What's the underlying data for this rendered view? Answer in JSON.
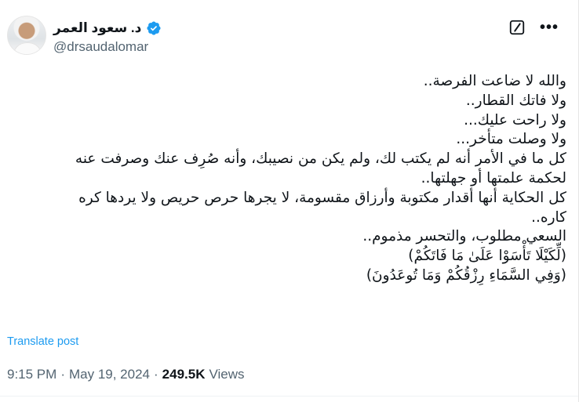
{
  "author": {
    "name": "د. سعود العمر",
    "handle": "@drsaudalomar"
  },
  "icons": {
    "verified": "verified-badge-icon",
    "grok": "grok-icon",
    "more": "more-icon"
  },
  "colors": {
    "accent": "#1d9bf0",
    "muted": "#536471",
    "text": "#0f1419"
  },
  "tweet": {
    "lines": [
      "والله لا ضاعت الفرصة..",
      "ولا فاتك القطار..",
      "ولا راحت عليك...",
      "ولا وصلت متأخر...",
      "كل ما في الأمر أنه لم يكتب لك، ولم يكن من نصيبك، وأنه صُرِف عنك وصرفت عنه",
      "لحكمة علمتها أو جهلتها..",
      "كل الحكاية أنها أقدار مكتوبة وأرزاق مقسومة، لا يجرها حرص حريص ولا يردها كره",
      "كاره..",
      "السعي مطلوب، والتحسر مذموم..",
      "(لِّكَيْلَا تَأْسَوْا عَلَىٰ مَا فَاتَكُمْ)",
      "(وَفِي السَّمَاءِ رِزْقُكُمْ وَمَا تُوعَدُونَ)"
    ]
  },
  "translate_label": "Translate post",
  "meta": {
    "time": "9:15 PM",
    "sep1": "·",
    "date": "May 19, 2024",
    "sep2": "·",
    "views_count": "249.5K",
    "views_label": "Views"
  }
}
